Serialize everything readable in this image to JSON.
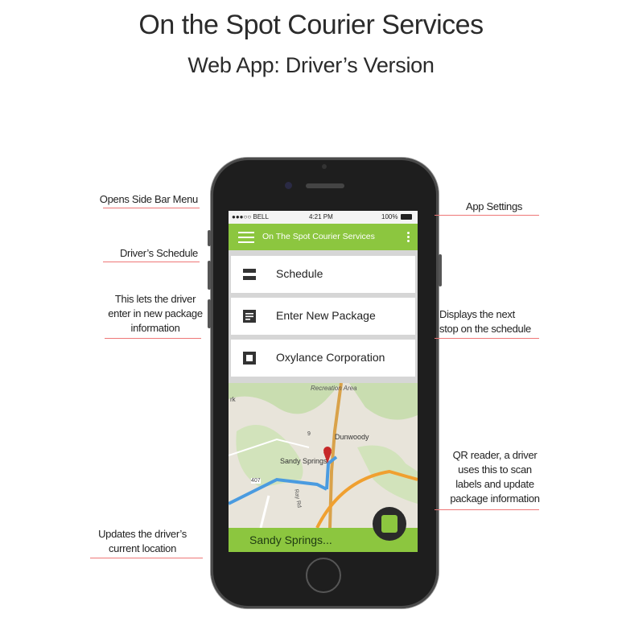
{
  "header": {
    "title": "On the Spot Courier Services",
    "subtitle": "Web App: Driver’s Version"
  },
  "phone": {
    "status": {
      "carrier": "●●●○○ BELL",
      "time": "4:21 PM",
      "battery": "100%"
    },
    "appbar": {
      "title": "On The Spot Courier Services"
    },
    "cards": [
      {
        "label": "Schedule",
        "icon": "schedule-icon"
      },
      {
        "label": "Enter New Package",
        "icon": "package-icon"
      },
      {
        "label": "Oxylance Corporation",
        "icon": "stop-icon"
      }
    ],
    "map": {
      "labels": [
        "Recreation Area",
        "Dunwoody",
        "Sandy Springs",
        "rk",
        "9",
        "407",
        "Ray Rd"
      ]
    },
    "location_bar": {
      "text": "Sandy Springs..."
    },
    "colors": {
      "accent": "#8cc63f",
      "dark": "#1e1e1e"
    }
  },
  "annotations": {
    "side_menu": "Opens Side Bar Menu",
    "schedule": "Driver’s Schedule",
    "new_package_1": "This lets the driver",
    "new_package_2": "enter in new package",
    "new_package_3": "information",
    "settings": "App Settings",
    "next_stop_1": "Displays the next",
    "next_stop_2": "stop on the schedule",
    "qr_1": "QR reader, a driver",
    "qr_2": "uses this to scan",
    "qr_3": "labels and update",
    "qr_4": "package information",
    "location_1": "Updates the driver’s",
    "location_2": "current location"
  }
}
